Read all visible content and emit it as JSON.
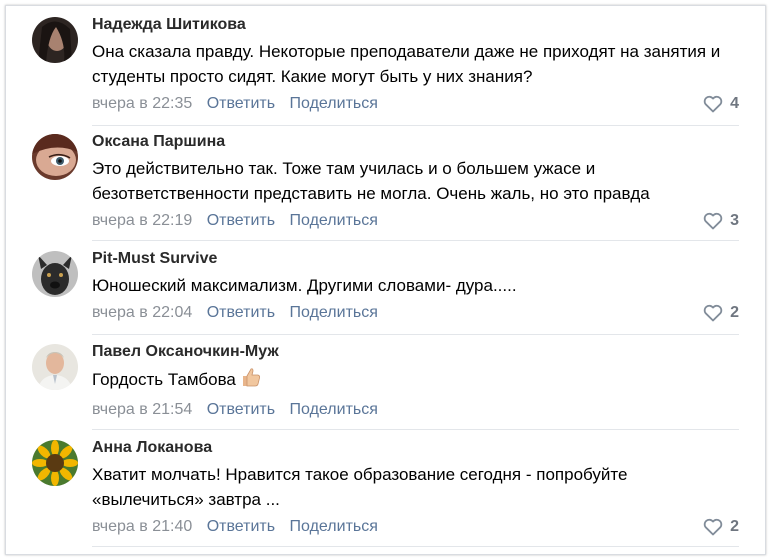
{
  "comments": [
    {
      "author": "Надежда Шитикова",
      "text": "Она сказала правду. Некоторые преподаватели даже не приходят на занятия и студенты просто сидят. Какие могут быть у них знания?",
      "time": "вчера в 22:35",
      "reply": "Ответить",
      "share": "Поделиться",
      "likes": "4"
    },
    {
      "author": "Оксана Паршина",
      "text": "Это действительно так. Тоже там училась и о большем ужасе и безответственности представить не могла. Очень жаль, но это правда",
      "time": "вчера в 22:19",
      "reply": "Ответить",
      "share": "Поделиться",
      "likes": "3"
    },
    {
      "author": "Pit-Must Survive",
      "text": "Юношеский максимализм. Другими словами- дура.....",
      "time": "вчера в 22:04",
      "reply": "Ответить",
      "share": "Поделиться",
      "likes": "2"
    },
    {
      "author": "Павел Оксаночкин-Муж",
      "text": "Гордость Тамбова",
      "emoji": "thumbs-up",
      "time": "вчера в 21:54",
      "reply": "Ответить",
      "share": "Поделиться",
      "likes": ""
    },
    {
      "author": "Анна Локанова",
      "text": "Хватит молчать! Нравится такое образование сегодня - попробуйте «вылечиться» завтра ...",
      "time": "вчера в 21:40",
      "reply": "Ответить",
      "share": "Поделиться",
      "likes": "2"
    }
  ],
  "colors": {
    "link": "#5a7598",
    "meta": "#8a8f96",
    "divider": "#e3e6ea"
  },
  "icons": [
    "heart-icon",
    "thumbs-up-icon"
  ]
}
